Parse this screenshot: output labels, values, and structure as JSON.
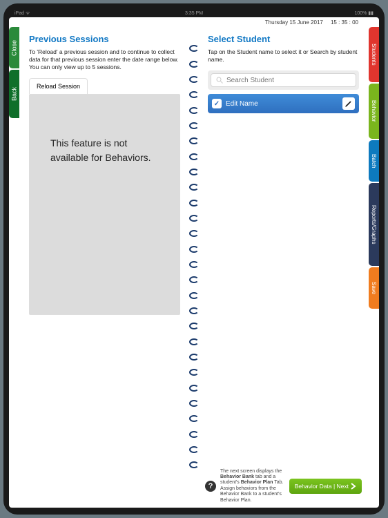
{
  "status_bar": {
    "left": "iPad ᯤ",
    "center": "3:35 PM",
    "right": "100% ▮▮"
  },
  "datetime": {
    "date": "Thursday 15 June 2017",
    "time": "15 : 35 : 00"
  },
  "left_tabs": {
    "close": "Close",
    "back": "Back"
  },
  "right_tabs": {
    "students": "Students",
    "behavior": "Behavior",
    "batch": "Batch",
    "reports": "Reports/Graphs",
    "save": "Save"
  },
  "left_page": {
    "title": "Previous Sessions",
    "desc": "To 'Reload' a previous session and to continue to collect data for that previous session enter the date range below. You can only view up to 5 sessions.",
    "tab_label": "Reload Session",
    "panel_text": "This feature is not available for Behaviors."
  },
  "right_page": {
    "title": "Select Student",
    "desc": "Tap on the Student name to select it or Search by student name.",
    "search_placeholder": "Search Student",
    "student_row": {
      "label": "Edit Name",
      "checked": true
    },
    "footer_text_parts": {
      "p1": "The next screen displays the ",
      "b1": "Behavior Bank",
      "p2": " tab and a student's ",
      "b2": "Behavior Plan",
      "p3": " Tab. Assign behaviors from the Behavior Bank to a student's Behavior Plan."
    },
    "next_label": "Behavior Data | Next"
  }
}
